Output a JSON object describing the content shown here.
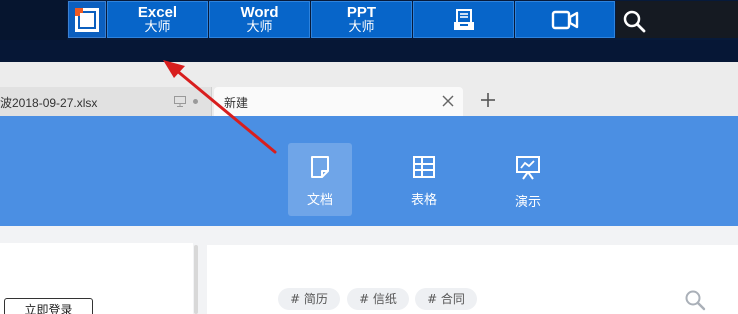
{
  "topbar": {
    "logo_icon": "app-logo-icon",
    "buttons": [
      {
        "en": "Excel",
        "zh": "大师"
      },
      {
        "en": "Word",
        "zh": "大师"
      },
      {
        "en": "PPT",
        "zh": "大师"
      }
    ],
    "icons": [
      "document-tray-icon",
      "video-camera-icon",
      "search-icon"
    ]
  },
  "tabs": {
    "inactive_tab": {
      "label": "波2018-09-27.xlsx"
    },
    "active_tab": {
      "label": "新建"
    },
    "icons": [
      "monitor-icon",
      "close-icon",
      "plus-icon"
    ]
  },
  "band": {
    "items": [
      {
        "label": "文档",
        "icon": "document-icon",
        "active": true
      },
      {
        "label": "表格",
        "icon": "table-icon",
        "active": false
      },
      {
        "label": "演示",
        "icon": "presentation-icon",
        "active": false
      }
    ],
    "accent_color": "#4b8fe3"
  },
  "sidebar": {
    "login_label": "立即登录"
  },
  "tags": [
    {
      "label": "# 简历"
    },
    {
      "label": "# 信纸"
    },
    {
      "label": "# 合同"
    }
  ],
  "annotation": {
    "arrow_color": "#e02020"
  }
}
